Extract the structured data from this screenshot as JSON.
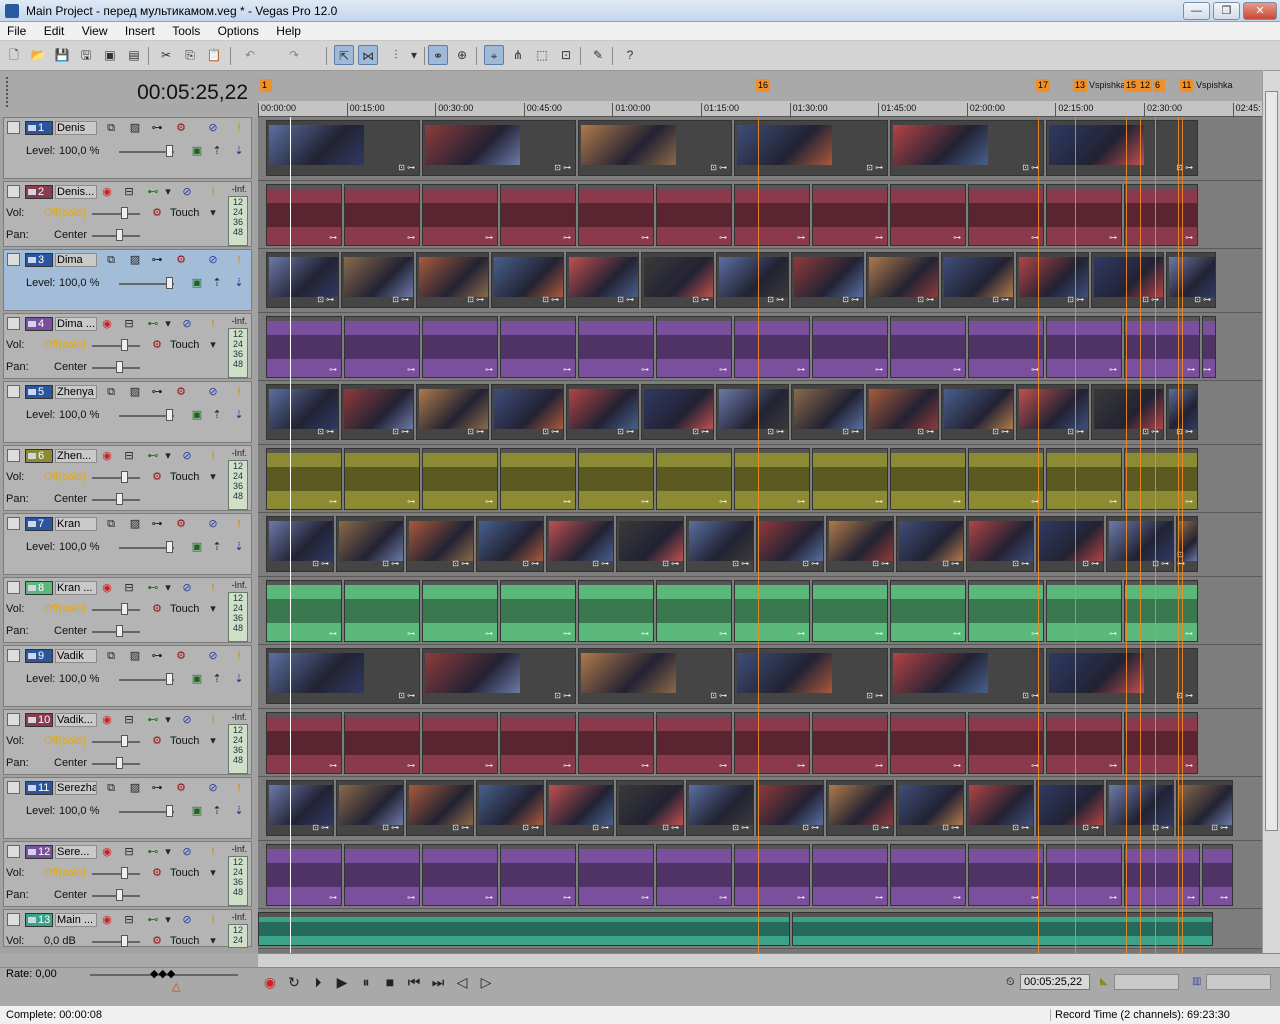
{
  "window": {
    "title": "Main Project - перед мультикамом.veg * - Vegas Pro 12.0",
    "min": "—",
    "max": "❐",
    "close": "✕"
  },
  "menu": [
    "File",
    "Edit",
    "View",
    "Insert",
    "Tools",
    "Options",
    "Help"
  ],
  "timecode": "00:05:25,22",
  "tracks": [
    {
      "num": "1",
      "name": "Denis",
      "type": "video",
      "level_label": "Level:",
      "level": "100,0 %"
    },
    {
      "num": "2",
      "name": "Denis...",
      "type": "audio",
      "vol_label": "Vol:",
      "vol": "Off(solo)",
      "pan_label": "Pan:",
      "pan": "Center",
      "auto": "Touch",
      "inf": "-Inf."
    },
    {
      "num": "3",
      "name": "Dima",
      "type": "video",
      "level_label": "Level:",
      "level": "100,0 %"
    },
    {
      "num": "4",
      "name": "Dima ...",
      "type": "audio",
      "vol_label": "Vol:",
      "vol": "Off(solo)",
      "pan_label": "Pan:",
      "pan": "Center",
      "auto": "Touch",
      "inf": "-Inf."
    },
    {
      "num": "5",
      "name": "Zhenya",
      "type": "video",
      "level_label": "Level:",
      "level": "100,0 %"
    },
    {
      "num": "6",
      "name": "Zhen...",
      "type": "audio",
      "vol_label": "Vol:",
      "vol": "Off(solo)",
      "pan_label": "Pan:",
      "pan": "Center",
      "auto": "Touch",
      "inf": "-Inf."
    },
    {
      "num": "7",
      "name": "Kran",
      "type": "video",
      "level_label": "Level:",
      "level": "100,0 %"
    },
    {
      "num": "8",
      "name": "Kran ...",
      "type": "audio",
      "vol_label": "Vol:",
      "vol": "Off(solo)",
      "pan_label": "Pan:",
      "pan": "Center",
      "auto": "Touch",
      "inf": "-Inf."
    },
    {
      "num": "9",
      "name": "Vadik",
      "type": "video",
      "level_label": "Level:",
      "level": "100,0 %"
    },
    {
      "num": "10",
      "name": "Vadik...",
      "type": "audio",
      "vol_label": "Vol:",
      "vol": "Off(solo)",
      "pan_label": "Pan:",
      "pan": "Center",
      "auto": "Touch",
      "inf": "-Inf."
    },
    {
      "num": "11",
      "name": "Serezha",
      "type": "video",
      "level_label": "Level:",
      "level": "100,0 %"
    },
    {
      "num": "12",
      "name": "Sere...",
      "type": "audio",
      "vol_label": "Vol:",
      "vol": "Off(solo)",
      "pan_label": "Pan:",
      "pan": "Center",
      "auto": "Touch",
      "inf": "-Inf."
    },
    {
      "num": "13",
      "name": "Main ...",
      "type": "audio",
      "vol_label": "Vol:",
      "vol": "0,0 dB",
      "pan_label": "",
      "pan": "",
      "auto": "Touch",
      "inf": "-Inf."
    }
  ],
  "meter_scale": [
    "12",
    "24",
    "36",
    "48"
  ],
  "ruler": [
    "00:00:00",
    "00:15:00",
    "00:30:00",
    "00:45:00",
    "01:00:00",
    "01:15:00",
    "01:30:00",
    "01:45:00",
    "02:00:00",
    "02:15:00",
    "02:30:00",
    "02:45:"
  ],
  "markers": [
    {
      "label": "1"
    },
    {
      "label": "16"
    },
    {
      "label": "17"
    },
    {
      "label": "13",
      "name": "Vspishka"
    },
    {
      "label": "15"
    },
    {
      "label": "12"
    },
    {
      "label": "6"
    },
    {
      "label": "11",
      "name": "Vspishka"
    }
  ],
  "transport": {
    "rate": "Rate: 0,00",
    "timecode": "00:05:25,22"
  },
  "status": {
    "left": "Complete: 00:00:08",
    "right": "Record Time (2 channels): 69:23:30"
  },
  "colors": {
    "audio2": "#8a3a4c",
    "audio4": "#7a4f9e",
    "audio6": "#8d8a34",
    "audio8": "#59b87a",
    "audio10": "#8a3a4c",
    "audio12": "#7a4f9e",
    "audio13": "#3aa38a",
    "marker": "#f0902a"
  }
}
